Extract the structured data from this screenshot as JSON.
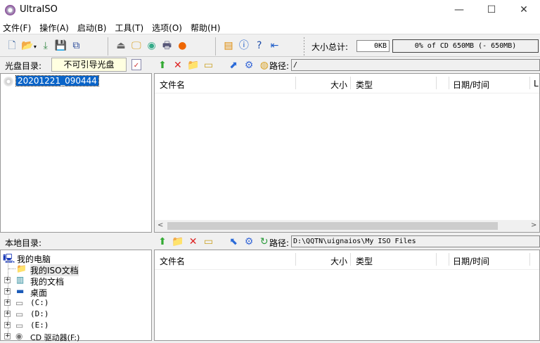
{
  "title": "UltraISO",
  "menu": [
    "文件(F)",
    "操作(A)",
    "启动(B)",
    "工具(T)",
    "选项(O)",
    "帮助(H)"
  ],
  "size_total_label": "大小总计:",
  "size_total_value": "0KB",
  "capacity": "0% of CD 650MB (- 650MB)",
  "disc_dir_label": "光盘目录:",
  "boot_status": "不可引导光盘",
  "path_label": "路径:",
  "iso_path": "/",
  "iso_root": "20201221_090444",
  "columns": {
    "name": "文件名",
    "size": "大小",
    "type": "类型",
    "date": "日期/时间",
    "extra": "L"
  },
  "local_dir_label": "本地目录:",
  "local_path": "D:\\QQTN\\uignaios\\My ISO Files",
  "local_tree": [
    "我的电脑",
    "我的ISO文档",
    "我的文档",
    "桌面",
    "(C:)",
    "(D:)",
    "(E:)",
    "CD 驱动器(F:)"
  ]
}
